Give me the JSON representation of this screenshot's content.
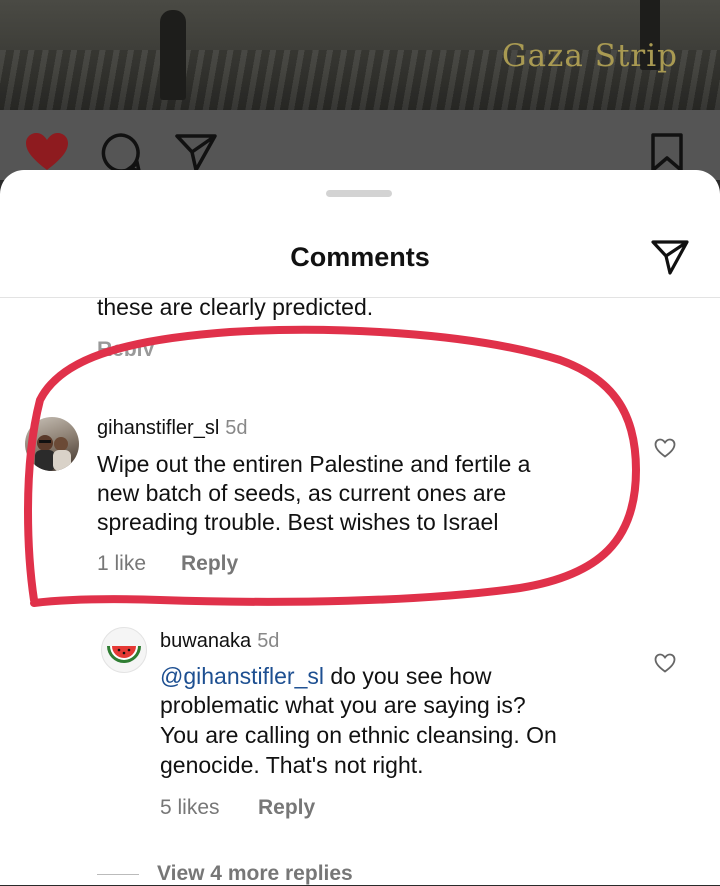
{
  "post": {
    "overlay_text": "Gaza Strip"
  },
  "action_bar": {
    "icons": [
      "heart-filled-icon",
      "comment-icon",
      "share-icon",
      "bookmark-icon"
    ],
    "liked_color": "#c4161c"
  },
  "sheet": {
    "title": "Comments"
  },
  "previous_comment": {
    "text": "these are clearly predicted.",
    "reply_label": "Reply"
  },
  "comment": {
    "username": "gihanstifler_sl",
    "time": "5d",
    "lines": [
      "Wipe out the entiren Palestine and fertile a",
      "new batch of seeds, as current ones are",
      "spreading trouble. Best wishes to Israel"
    ],
    "likes": "1 like",
    "reply_label": "Reply"
  },
  "reply": {
    "username": "buwanaka",
    "time": "5d",
    "mention": "@gihanstifler_sl",
    "first_line_rest": " do you see how",
    "lines": [
      "problematic what you are saying is?",
      "You are calling on ethnic cleansing. On",
      "genocide. That's not right."
    ],
    "likes": "5 likes",
    "reply_label": "Reply"
  },
  "view_more": "View 4 more replies",
  "annotation_color": "#e0314a"
}
